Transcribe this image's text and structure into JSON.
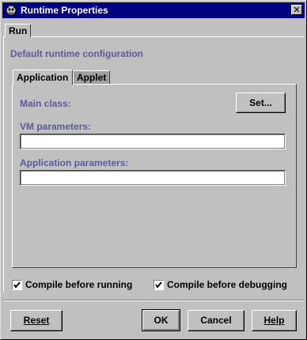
{
  "window": {
    "title": "Runtime Properties"
  },
  "outer_tabs": [
    {
      "label": "Run",
      "active": true
    }
  ],
  "heading": "Default runtime configuration",
  "inner_tabs": [
    {
      "label": "Application",
      "active": true
    },
    {
      "label": "Applet",
      "active": false
    }
  ],
  "application": {
    "main_class_label": "Main class:",
    "set_button": "Set...",
    "vm_parameters_label": "VM parameters:",
    "vm_parameters_value": "",
    "app_parameters_label": "Application parameters:",
    "app_parameters_value": ""
  },
  "options": {
    "compile_before_running": {
      "label": "Compile before running",
      "checked": true
    },
    "compile_before_debugging": {
      "label": "Compile before debugging",
      "checked": true
    }
  },
  "buttons": {
    "reset": "Reset",
    "ok": "OK",
    "cancel": "Cancel",
    "help": "Help"
  },
  "colors": {
    "titlebar": "#000080",
    "label_text": "#5a5a9a",
    "face": "#c0c0c0"
  }
}
